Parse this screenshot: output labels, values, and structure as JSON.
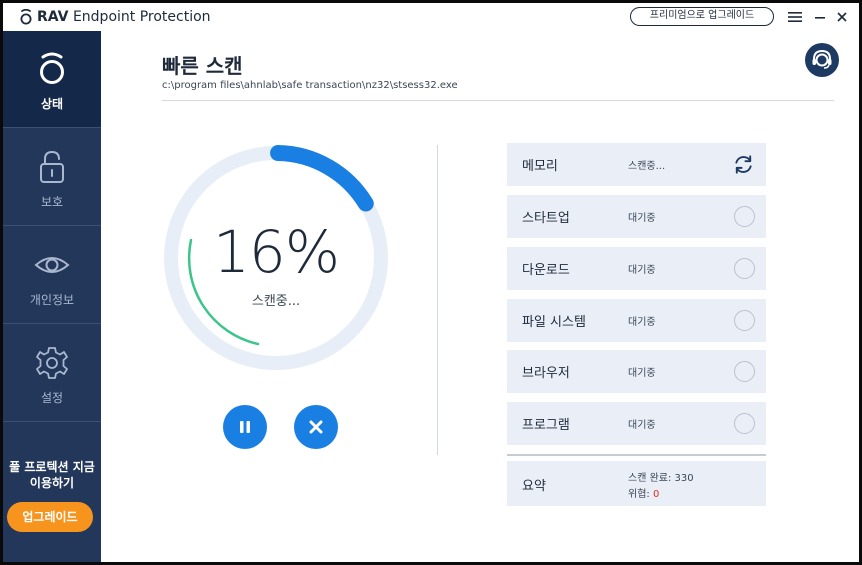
{
  "app": {
    "brand": "RAV",
    "title_rest": "Endpoint Protection",
    "upgrade_label": "프리미엄으로 업그레이드"
  },
  "sidebar": {
    "items": [
      {
        "label": "상태",
        "icon": "rav-status-icon",
        "active": true
      },
      {
        "label": "보호",
        "icon": "lock-icon",
        "active": false
      },
      {
        "label": "개인정보",
        "icon": "eye-icon",
        "active": false
      },
      {
        "label": "설정",
        "icon": "gear-icon",
        "active": false
      }
    ],
    "promo_line1": "풀 프로텍션 지금",
    "promo_line2": "이용하기",
    "promo_button": "업그레이드"
  },
  "main": {
    "title": "빠른 스캔",
    "current_path": "c:\\program files\\ahnlab\\safe transaction\\nz32\\stsess32.exe",
    "progress_percent": 16,
    "progress_text": "16%",
    "progress_status": "스캔중...",
    "tasks": [
      {
        "name": "메모리",
        "status": "스캔중...",
        "state": "scanning"
      },
      {
        "name": "스타트업",
        "status": "대기중",
        "state": "waiting"
      },
      {
        "name": "다운로드",
        "status": "대기중",
        "state": "waiting"
      },
      {
        "name": "파일 시스템",
        "status": "대기중",
        "state": "waiting"
      },
      {
        "name": "브라우저",
        "status": "대기중",
        "state": "waiting"
      },
      {
        "name": "프로그램",
        "status": "대기중",
        "state": "waiting"
      }
    ],
    "summary": {
      "label": "요약",
      "scan_done_label": "스캔 완료: ",
      "scan_done_value": "330",
      "threat_label": "위협: ",
      "threat_value": "0"
    }
  },
  "colors": {
    "sidebar": "#22375a",
    "sidebar_active": "#14284a",
    "accent": "#1a7fe3",
    "promo": "#f7941d",
    "threat": "#e0301e",
    "row_bg": "#eaeff7",
    "ring_track": "#e8eef7",
    "ring_green": "#3cc58a"
  }
}
